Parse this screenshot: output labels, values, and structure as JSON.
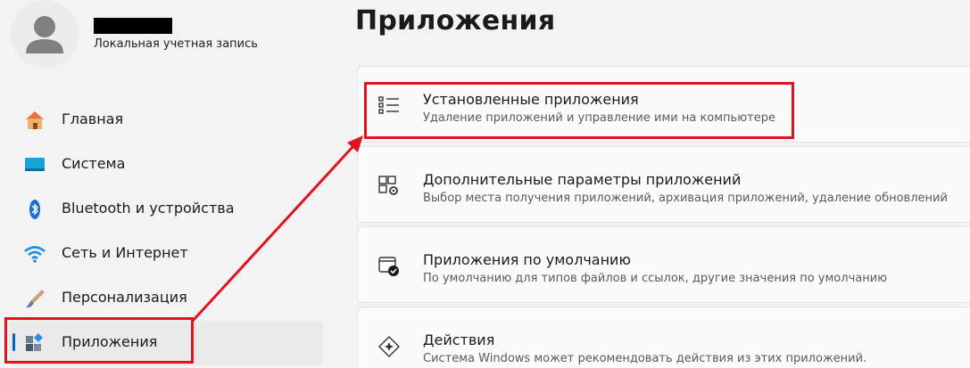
{
  "profile": {
    "account_type": "Локальная учетная запись",
    "avatar_icon": "user-icon"
  },
  "sidebar": {
    "items": [
      {
        "label": "Главная",
        "icon": "home-icon"
      },
      {
        "label": "Система",
        "icon": "monitor-icon"
      },
      {
        "label": "Bluetooth и устройства",
        "icon": "bluetooth-icon"
      },
      {
        "label": "Сеть и Интернет",
        "icon": "wifi-icon"
      },
      {
        "label": "Персонализация",
        "icon": "brush-icon"
      },
      {
        "label": "Приложения",
        "icon": "apps-icon",
        "active": true
      }
    ]
  },
  "main": {
    "title": "Приложения",
    "cards": [
      {
        "title": "Установленные приложения",
        "desc": "Удаление приложений и управление ими на компьютере",
        "icon": "list-icon"
      },
      {
        "title": "Дополнительные параметры приложений",
        "desc": "Выбор места получения приложений, архивация приложений, удаление обновлений",
        "icon": "app-settings-icon"
      },
      {
        "title": "Приложения по умолчанию",
        "desc": "По умолчанию для типов файлов и ссылок, другие значения по умолчанию",
        "icon": "default-apps-icon"
      },
      {
        "title": "Действия",
        "desc": "Система Windows может рекомендовать действия из этих приложений.",
        "icon": "actions-icon"
      }
    ]
  },
  "colors": {
    "accent": "#0067c0",
    "annotation": "#e0141e",
    "background": "#f3f3f3",
    "card": "#fbfbfb"
  }
}
